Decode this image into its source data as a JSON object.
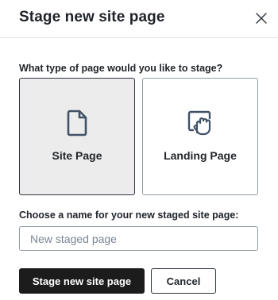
{
  "modal": {
    "title": "Stage new site page"
  },
  "page_type": {
    "question": "What type of page would you like to stage?",
    "options": [
      {
        "label": "Site Page",
        "icon": "document-icon",
        "selected": true
      },
      {
        "label": "Landing Page",
        "icon": "hand-tap-icon",
        "selected": false
      }
    ]
  },
  "name_field": {
    "label": "Choose a name for your new staged site page:",
    "placeholder": "New staged page",
    "value": ""
  },
  "actions": {
    "primary_label": "Stage new site page",
    "cancel_label": "Cancel"
  },
  "colors": {
    "primary_button": "#1c1c1c",
    "selected_card_bg": "#ececec",
    "icon_color": "#3f5266"
  }
}
